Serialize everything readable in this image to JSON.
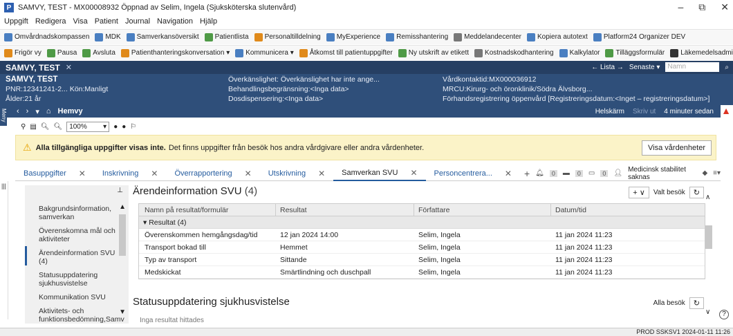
{
  "window": {
    "title": "SAMVY, TEST - MX00008932 Öppnad av Selim, Ingela (Sjuksköterska slutenvård)",
    "app_letter": "P",
    "controls": [
      "–",
      "⧉",
      "✕"
    ]
  },
  "menu": [
    "Uppgift",
    "Redigera",
    "Visa",
    "Patient",
    "Journal",
    "Navigation",
    "Hjälp"
  ],
  "toolbar1": [
    "Omvårdnadskompassen",
    "MDK",
    "Samverkansöversikt",
    "Patientlista",
    "Personaltilldelning",
    "MyExperience",
    "Remisshantering",
    "Meddelandecenter",
    "Kopiera autotext",
    "Platform24 Organizer DEV"
  ],
  "toolbar2": [
    "Frigör vy",
    "Pausa",
    "Avsluta",
    "Patienthanteringskonversation ▾",
    "Kommunicera ▾",
    "Åtkomst till patientuppgifter",
    "Ny utskrift av etikett",
    "Kostnadskodhantering",
    "Kalkylator",
    "Tilläggsformulär",
    "Läkemedelsadministrering"
  ],
  "patient_tab": {
    "name": "SAMVY, TEST",
    "lista": "← Lista →",
    "senaste": "Senaste ▾",
    "name_placeholder": "Namn"
  },
  "patient": {
    "name": "SAMVY, TEST",
    "pnr": "PNR:12341241-2...",
    "kon": "Kön:Manligt",
    "alder": "Ålder:21 år",
    "overkanslighet": "Överkänslighet: Överkänslighet har inte ange...",
    "behandling": "Behandlingsbegränsning:<Inga data>",
    "dosdisp": "Dosdispensering:<Inga data>",
    "vardkontakt": "Vårdkontaktid:MX000036912",
    "mrcu": "MRCU:Kirurg- och öronklinik/Södra Älvsborg...",
    "forhand": "Förhandsregistrering öppenvård [Registreringsdatum:<Inget – registreringsdatum>] Plats:..."
  },
  "nav": {
    "meny": "Meny",
    "hemvy": "Hemvy",
    "helskarm": "Helskärm",
    "skriv_ut": "Skriv ut",
    "updated": "4 minuter sedan"
  },
  "subtool": {
    "zoom": "100%"
  },
  "warning": {
    "bold": "Alla tillgängliga uppgifter visas inte.",
    "text": "Det finns uppgifter från besök hos andra vårdgivare eller andra vårdenheter.",
    "button": "Visa vårdenheter"
  },
  "tabs": [
    "Basuppgifter",
    "Inskrivning",
    "Överrapportering",
    "Utskrivning",
    "Samverkan SVU",
    "Personcentrera..."
  ],
  "tab_extra": {
    "count": "0",
    "medstat": "Medicinsk stabilitet saknas"
  },
  "sidebar": [
    "Bakgrundsinformation, samverkan",
    "Överenskomna mål och aktiviteter",
    "Ärendeinformation SVU (4)",
    "Statusuppdatering sjukhusvistelse",
    "Kommunikation SVU",
    "Aktivitets- och funktionsbedömning,Samv"
  ],
  "section1": {
    "title": "Ärendeinformation SVU",
    "count": "(4)",
    "valt_besok": "Valt besök",
    "plus": "+",
    "columns": [
      "Namn på resultat/formulär",
      "Resultat",
      "Författare",
      "Datum/tid"
    ],
    "group": "▾ Resultat (4)",
    "rows": [
      [
        "Överenskommen hemgångsdag/tid",
        "12 jan 2024 14:00",
        "Selim, Ingela",
        "11 jan 2024 11:23"
      ],
      [
        "Transport bokad till",
        "Hemmet",
        "Selim, Ingela",
        "11 jan 2024 11:23"
      ],
      [
        "Typ av transport",
        "Sittande",
        "Selim, Ingela",
        "11 jan 2024 11:23"
      ],
      [
        "Medskickat",
        "Smärtlindning och duschpall",
        "Selim, Ingela",
        "11 jan 2024 11:23"
      ]
    ]
  },
  "section2": {
    "title": "Statusuppdatering sjukhusvistelse",
    "alla_besok": "Alla besök",
    "noresult": "Inga resultat hittades"
  },
  "status": "PROD   SSKSV1   2024-01-11   11:26"
}
